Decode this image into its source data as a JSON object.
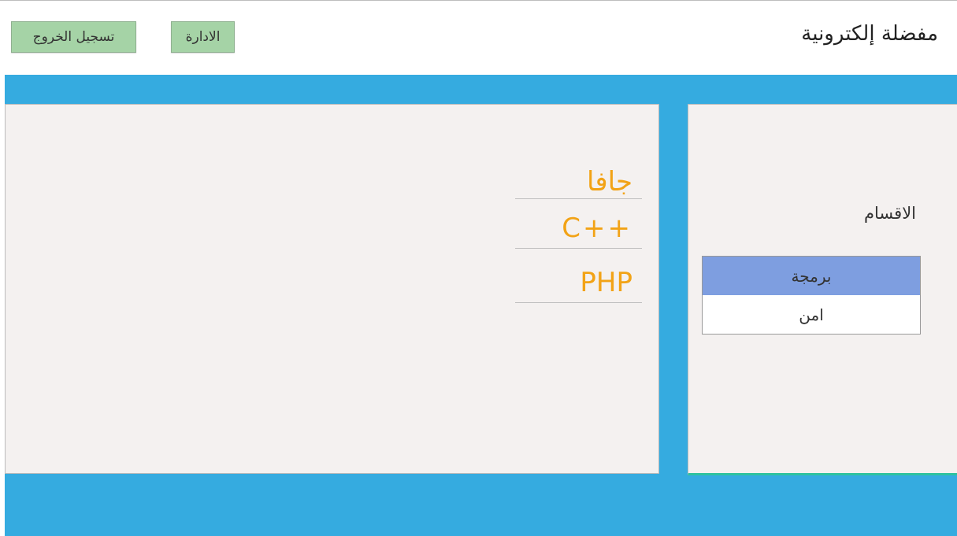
{
  "app": {
    "title": "مفضلة إلكترونية"
  },
  "header": {
    "logout_label": "تسجيل الخروج",
    "admin_label": "الادارة"
  },
  "content": {
    "languages": [
      "جافا",
      "C++",
      "PHP"
    ]
  },
  "sidebar": {
    "heading": "الاقسام",
    "categories": [
      {
        "label": "برمجة",
        "selected": true
      },
      {
        "label": "امن",
        "selected": false
      }
    ]
  },
  "colors": {
    "header_bar": "#35abe0",
    "button_bg": "#a5d3a6",
    "panel_bg": "#f4f1f0",
    "language_text": "#f2a316",
    "selected_category": "#7e9ee0",
    "panel_accent_border": "#2ec2a0"
  }
}
